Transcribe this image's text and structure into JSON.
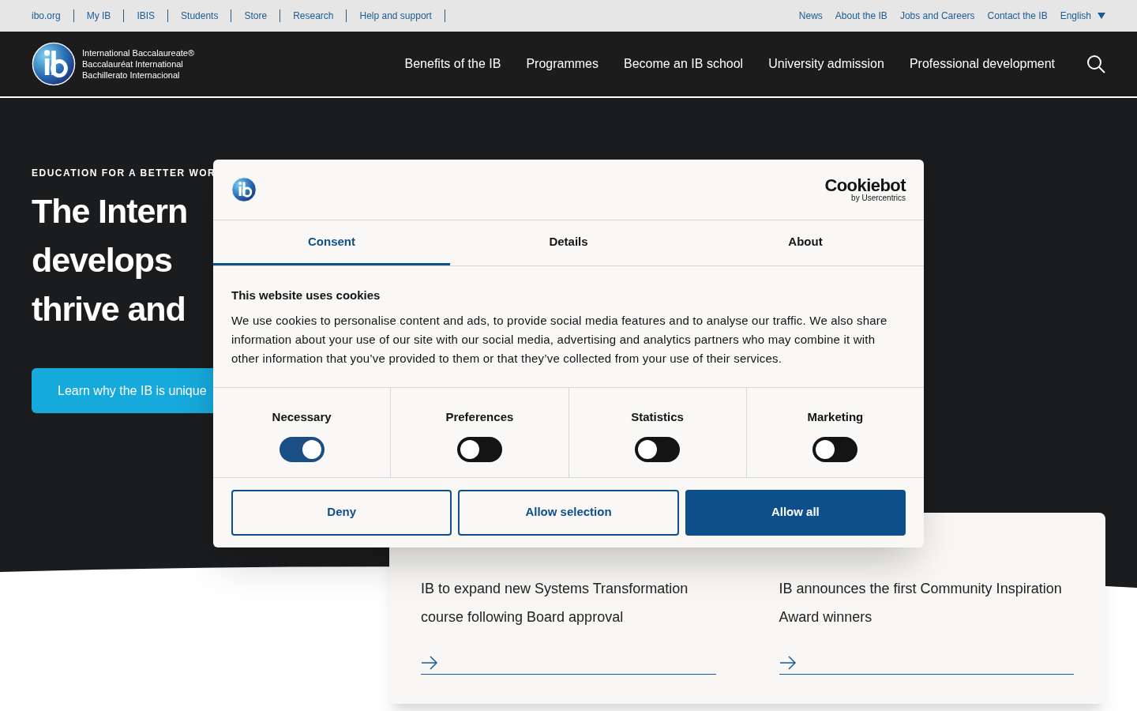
{
  "utility_bar": {
    "left_links": [
      "ibo.org",
      "My IB",
      "IBIS",
      "Students",
      "Store",
      "Research",
      "Help and support"
    ],
    "right_links": [
      "News",
      "About the IB",
      "Jobs and Careers",
      "Contact the IB"
    ],
    "language": "English"
  },
  "header": {
    "logo_lines": [
      "International Baccalaureate®",
      "Baccalauréat International",
      "Bachillerato Internacional"
    ],
    "nav": [
      "Benefits of the IB",
      "Programmes",
      "Become an IB school",
      "University admission",
      "Professional development"
    ]
  },
  "hero": {
    "eyebrow": "EDUCATION FOR A BETTER WOR",
    "title_lines": [
      "The Intern",
      "develops",
      "thrive and"
    ],
    "button": "Learn why the IB is unique"
  },
  "news": [
    {
      "title": "IB to expand new Systems Transformation course following Board approval"
    },
    {
      "title": "IB announces the first Community Inspiration Award winners"
    }
  ],
  "cookie_dialog": {
    "brand": "Cookiebot",
    "brand_sub": "by Usercentrics",
    "tabs": [
      {
        "label": "Consent",
        "selected": true
      },
      {
        "label": "Details",
        "selected": false
      },
      {
        "label": "About",
        "selected": false
      }
    ],
    "heading": "This website uses cookies",
    "body": "We use cookies to personalise content and ads, to provide social media features and to analyse our traffic. We also share information about your use of our site with our social media, advertising and analytics partners who may combine it with other information that you’ve provided to them or that they’ve collected from your use of their services.",
    "categories": [
      {
        "label": "Necessary",
        "on": true
      },
      {
        "label": "Preferences",
        "on": false
      },
      {
        "label": "Statistics",
        "on": false
      },
      {
        "label": "Marketing",
        "on": false
      }
    ],
    "buttons": [
      {
        "label": "Deny",
        "kind": "outline"
      },
      {
        "label": "Allow selection",
        "kind": "outline"
      },
      {
        "label": "Allow all",
        "kind": "primary"
      }
    ]
  }
}
